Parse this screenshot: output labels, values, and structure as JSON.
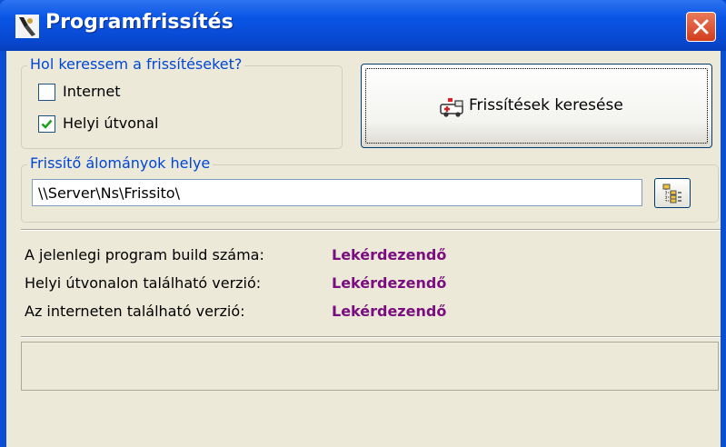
{
  "window": {
    "title": "Programfrissítés",
    "close_icon": "close-icon"
  },
  "search_source": {
    "legend": "Hol keressem a frissítéseket?",
    "options": [
      {
        "label": "Internet",
        "checked": false
      },
      {
        "label": "Helyi útvonal",
        "checked": true
      }
    ]
  },
  "search_button": {
    "label": "Frissítések keresése",
    "icon": "ambulance-icon"
  },
  "location": {
    "legend": "Frissítő álományok helye",
    "path_value": "\\\\Server\\Ns\\Frissito\\",
    "browse_icon": "folder-tree-icon"
  },
  "info": {
    "rows": [
      {
        "label": "A jelenlegi program build száma:",
        "value": "Lekérdezendő"
      },
      {
        "label": "Helyi útvonalon található verzió:",
        "value": "Lekérdezendő"
      },
      {
        "label": "Az interneten található verzió:",
        "value": "Lekérdezendő"
      }
    ]
  },
  "colors": {
    "accent": "#0046d5",
    "value_color": "#7a0e80",
    "titlebar": "#0a55e6",
    "panel": "#ece9d8"
  }
}
